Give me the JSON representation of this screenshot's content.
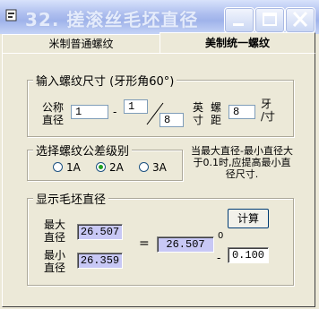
{
  "window": {
    "title": "32. 搓滚丝毛坯直径"
  },
  "tabs": [
    {
      "label": "米制普通螺纹"
    },
    {
      "label": "美制统一螺纹"
    }
  ],
  "thread_group": {
    "title": "输入螺纹尺寸 (牙形角60°)",
    "nominal_label": [
      "公称",
      "直径"
    ],
    "whole": "1",
    "dash": "-",
    "numerator": "1",
    "slash": "/",
    "denominator": "8",
    "unit_label": [
      "英",
      "寸"
    ],
    "pitch_label": [
      "螺",
      "距"
    ],
    "pitch_value": "8",
    "pitch_unit": [
      "牙",
      "/寸"
    ]
  },
  "tolerance_group": {
    "title": "选择螺纹公差级别",
    "options": [
      "1A",
      "2A",
      "3A"
    ],
    "selected": "2A"
  },
  "note": "当最大直径-最小直径大于0.1时,应提高最小直径尺寸.",
  "result_group": {
    "title": "显示毛坯直径",
    "max_label": [
      "最大",
      "直径"
    ],
    "min_label": [
      "最小",
      "直径"
    ],
    "max_value": "26.507",
    "min_value": "26.359",
    "equals": "=",
    "nominal_value": "26.507",
    "upper_dev": "0",
    "minus": "-",
    "lower_dev": "0.100",
    "calc_button": "计算"
  }
}
